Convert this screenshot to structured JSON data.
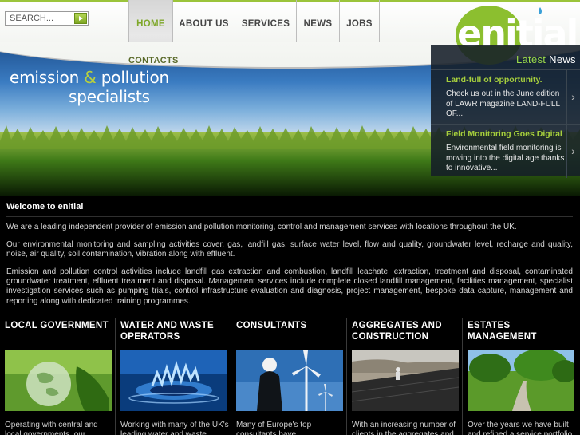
{
  "search": {
    "placeholder": "SEARCH..."
  },
  "nav": {
    "items": [
      "HOME",
      "ABOUT US",
      "SERVICES",
      "NEWS",
      "JOBS",
      "CONTACTS"
    ],
    "active": "HOME"
  },
  "logo": {
    "text": "enitial"
  },
  "hero": {
    "tagline_part1": "emission ",
    "tagline_amp": "&",
    "tagline_part2": " pollution",
    "tagline_line2": "specialists"
  },
  "latest_news": {
    "heading_latest": "Latest",
    "heading_news": " News",
    "items": [
      {
        "title": "Land-full of opportunity.",
        "body": "Check us out in the June edition of LAWR magazine LAND-FULL OF..."
      },
      {
        "title": "Field Monitoring Goes Digital",
        "body": "Environmental field monitoring is moving into the digital age thanks to innovative..."
      }
    ]
  },
  "welcome": {
    "title": "Welcome to enitial",
    "paragraphs": [
      "We are a leading independent provider of emission and pollution monitoring, control and management services with locations throughout the UK.",
      "Our environmental monitoring and sampling activities cover, gas, landfill gas, surface water level, flow and quality, groundwater level, recharge and quality, noise, air quality, soil contamination, vibration along with effluent.",
      "Emission and pollution control activities include landfill gas extraction and combustion, landfill leachate, extraction, treatment and disposal, contaminated groundwater treatment, effluent treatment and disposal.  Management services include complete closed landfill management, facilities management, specialist investigation services such as pumping trials, control infrastructure evaluation and diagnosis, project management, bespoke data capture, management and reporting along with dedicated training programmes."
    ]
  },
  "categories": [
    {
      "title": "LOCAL GOVERNMENT",
      "text": "Operating with central and local governments, our"
    },
    {
      "title": "WATER AND WASTE OPERATORS",
      "text": "Working with many of the UK's leading water and waste"
    },
    {
      "title": "CONSULTANTS",
      "text": "Many of Europe's top consultants have"
    },
    {
      "title": "AGGREGATES AND CONSTRUCTION",
      "text": "With an increasing number of clients in the aggregates and"
    },
    {
      "title": "ESTATES MANAGEMENT",
      "text": "Over the years we have built and refined a service portfolio"
    }
  ],
  "colors": {
    "accent": "#9bc43a",
    "news_title": "#a6cf3d",
    "background": "#000000"
  }
}
